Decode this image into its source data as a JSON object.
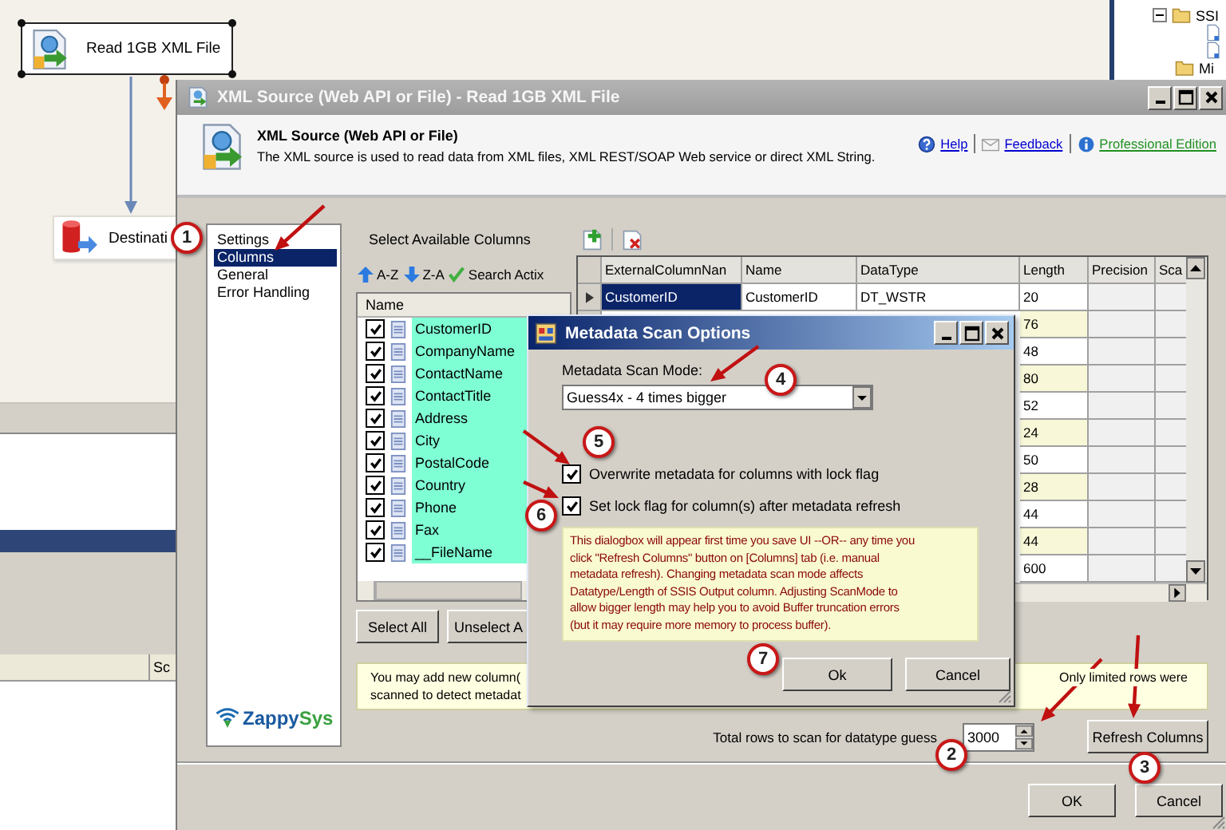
{
  "designer": {
    "nodes": [
      {
        "kind": "source",
        "label": "Read 1GB XML File",
        "selected": true
      },
      {
        "kind": "destination",
        "label": "Destinati",
        "selected": false
      }
    ]
  },
  "solution_explorer": {
    "items": [
      {
        "kind": "folder",
        "label": "SSI",
        "expanded": true
      },
      {
        "kind": "file"
      },
      {
        "kind": "file"
      },
      {
        "kind": "folder",
        "label": "Mi"
      }
    ]
  },
  "output_panel": {
    "column_header": "Sc"
  },
  "dialog": {
    "title": "XML Source (Web API or File) - Read 1GB XML File",
    "header_title": "XML Source (Web API or File)",
    "description": "The XML source is used to read data from XML files, XML REST/SOAP Web service or direct XML String.",
    "links": [
      {
        "kind": "help",
        "label": "Help"
      },
      {
        "kind": "feedback",
        "label": "Feedback"
      },
      {
        "kind": "info",
        "label": "Professional Edition"
      }
    ],
    "nav": [
      {
        "label": "Settings",
        "selected": false
      },
      {
        "label": "Columns",
        "selected": true
      },
      {
        "label": "General",
        "selected": false
      },
      {
        "label": "Error Handling",
        "selected": false
      }
    ],
    "logo": [
      "Zappy",
      "Sys"
    ],
    "columns_label": "Select Available Columns",
    "sort_buttons": [
      {
        "kind": "ascending",
        "label": "A-Z"
      },
      {
        "kind": "descending",
        "label": "Z-A"
      },
      {
        "kind": "check",
        "label": "Search Actix"
      }
    ],
    "column_list": {
      "header": "Name",
      "items": [
        {
          "name": "CustomerID",
          "checked": true
        },
        {
          "name": "CompanyName",
          "checked": true
        },
        {
          "name": "ContactName",
          "checked": true
        },
        {
          "name": "ContactTitle",
          "checked": true
        },
        {
          "name": "Address",
          "checked": true
        },
        {
          "name": "City",
          "checked": true
        },
        {
          "name": "PostalCode",
          "checked": true
        },
        {
          "name": "Country",
          "checked": true
        },
        {
          "name": "Phone",
          "checked": true
        },
        {
          "name": "Fax",
          "checked": true
        },
        {
          "name": "__FileName",
          "checked": true
        }
      ]
    },
    "list_buttons": [
      "Select All",
      "Unselect A"
    ],
    "grid": {
      "columns": [
        "ExternalColumnNan",
        "Name",
        "DataType",
        "Length",
        "Precision",
        "Sca"
      ],
      "rows": [
        {
          "external_column": "CustomerID",
          "name": "CustomerID",
          "data_type": "DT_WSTR",
          "length": "20",
          "selected": true
        },
        {
          "length": "76"
        },
        {
          "length": "48"
        },
        {
          "length": "80"
        },
        {
          "length": "52"
        },
        {
          "length": "24"
        },
        {
          "length": "50"
        },
        {
          "length": "28"
        },
        {
          "length": "44"
        },
        {
          "length": "44"
        },
        {
          "length": "600"
        }
      ]
    },
    "note_left": "You may add new column(\nscanned to detect metadat",
    "note_right": "Only limited rows were",
    "rows_label": "Total rows to scan for datatype guess",
    "rows_value": "3000",
    "refresh_button": "Refresh Columns",
    "buttons": [
      "OK",
      "Cancel"
    ]
  },
  "scan_dialog": {
    "title": "Metadata Scan Options",
    "mode_label": "Metadata Scan Mode:",
    "mode_value": "Guess4x - 4 times bigger",
    "options": [
      {
        "label": "Overwrite metadata for columns with lock flag",
        "checked": true
      },
      {
        "label": "Set lock flag for column(s) after metadata refresh",
        "checked": true
      }
    ],
    "info": "This dialogbox will appear first time you save UI --OR-- any time you\nclick \"Refresh Columns\" button on [Columns] tab (i.e. manual\nmetadata refresh). Changing metadata scan mode affects\nDatatype/Length of SSIS Output column. Adjusting ScanMode to\nallow bigger length may help you to avoid Buffer truncation errors\n(but it may require more memory to process buffer).",
    "buttons": [
      "Ok",
      "Cancel"
    ]
  },
  "callouts": [
    "1",
    "2",
    "3",
    "4",
    "5",
    "6",
    "7"
  ]
}
